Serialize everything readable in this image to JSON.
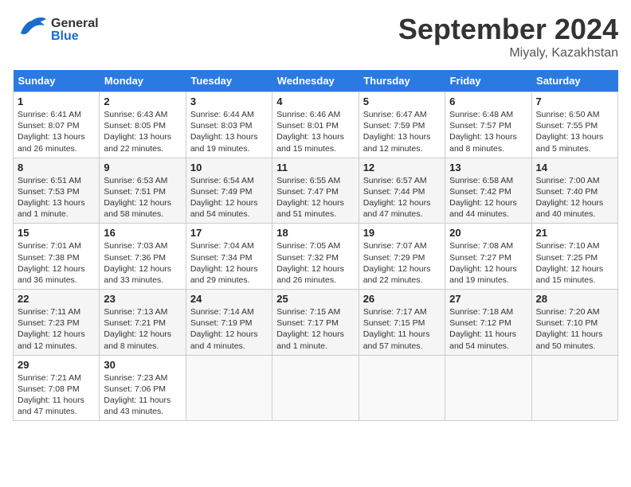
{
  "header": {
    "logo_general": "General",
    "logo_blue": "Blue",
    "month_title": "September 2024",
    "location": "Miyaly, Kazakhstan"
  },
  "days_of_week": [
    "Sunday",
    "Monday",
    "Tuesday",
    "Wednesday",
    "Thursday",
    "Friday",
    "Saturday"
  ],
  "weeks": [
    [
      {
        "day": "1",
        "sunrise": "Sunrise: 6:41 AM",
        "sunset": "Sunset: 8:07 PM",
        "daylight": "Daylight: 13 hours and 26 minutes."
      },
      {
        "day": "2",
        "sunrise": "Sunrise: 6:43 AM",
        "sunset": "Sunset: 8:05 PM",
        "daylight": "Daylight: 13 hours and 22 minutes."
      },
      {
        "day": "3",
        "sunrise": "Sunrise: 6:44 AM",
        "sunset": "Sunset: 8:03 PM",
        "daylight": "Daylight: 13 hours and 19 minutes."
      },
      {
        "day": "4",
        "sunrise": "Sunrise: 6:46 AM",
        "sunset": "Sunset: 8:01 PM",
        "daylight": "Daylight: 13 hours and 15 minutes."
      },
      {
        "day": "5",
        "sunrise": "Sunrise: 6:47 AM",
        "sunset": "Sunset: 7:59 PM",
        "daylight": "Daylight: 13 hours and 12 minutes."
      },
      {
        "day": "6",
        "sunrise": "Sunrise: 6:48 AM",
        "sunset": "Sunset: 7:57 PM",
        "daylight": "Daylight: 13 hours and 8 minutes."
      },
      {
        "day": "7",
        "sunrise": "Sunrise: 6:50 AM",
        "sunset": "Sunset: 7:55 PM",
        "daylight": "Daylight: 13 hours and 5 minutes."
      }
    ],
    [
      {
        "day": "8",
        "sunrise": "Sunrise: 6:51 AM",
        "sunset": "Sunset: 7:53 PM",
        "daylight": "Daylight: 13 hours and 1 minute."
      },
      {
        "day": "9",
        "sunrise": "Sunrise: 6:53 AM",
        "sunset": "Sunset: 7:51 PM",
        "daylight": "Daylight: 12 hours and 58 minutes."
      },
      {
        "day": "10",
        "sunrise": "Sunrise: 6:54 AM",
        "sunset": "Sunset: 7:49 PM",
        "daylight": "Daylight: 12 hours and 54 minutes."
      },
      {
        "day": "11",
        "sunrise": "Sunrise: 6:55 AM",
        "sunset": "Sunset: 7:47 PM",
        "daylight": "Daylight: 12 hours and 51 minutes."
      },
      {
        "day": "12",
        "sunrise": "Sunrise: 6:57 AM",
        "sunset": "Sunset: 7:44 PM",
        "daylight": "Daylight: 12 hours and 47 minutes."
      },
      {
        "day": "13",
        "sunrise": "Sunrise: 6:58 AM",
        "sunset": "Sunset: 7:42 PM",
        "daylight": "Daylight: 12 hours and 44 minutes."
      },
      {
        "day": "14",
        "sunrise": "Sunrise: 7:00 AM",
        "sunset": "Sunset: 7:40 PM",
        "daylight": "Daylight: 12 hours and 40 minutes."
      }
    ],
    [
      {
        "day": "15",
        "sunrise": "Sunrise: 7:01 AM",
        "sunset": "Sunset: 7:38 PM",
        "daylight": "Daylight: 12 hours and 36 minutes."
      },
      {
        "day": "16",
        "sunrise": "Sunrise: 7:03 AM",
        "sunset": "Sunset: 7:36 PM",
        "daylight": "Daylight: 12 hours and 33 minutes."
      },
      {
        "day": "17",
        "sunrise": "Sunrise: 7:04 AM",
        "sunset": "Sunset: 7:34 PM",
        "daylight": "Daylight: 12 hours and 29 minutes."
      },
      {
        "day": "18",
        "sunrise": "Sunrise: 7:05 AM",
        "sunset": "Sunset: 7:32 PM",
        "daylight": "Daylight: 12 hours and 26 minutes."
      },
      {
        "day": "19",
        "sunrise": "Sunrise: 7:07 AM",
        "sunset": "Sunset: 7:29 PM",
        "daylight": "Daylight: 12 hours and 22 minutes."
      },
      {
        "day": "20",
        "sunrise": "Sunrise: 7:08 AM",
        "sunset": "Sunset: 7:27 PM",
        "daylight": "Daylight: 12 hours and 19 minutes."
      },
      {
        "day": "21",
        "sunrise": "Sunrise: 7:10 AM",
        "sunset": "Sunset: 7:25 PM",
        "daylight": "Daylight: 12 hours and 15 minutes."
      }
    ],
    [
      {
        "day": "22",
        "sunrise": "Sunrise: 7:11 AM",
        "sunset": "Sunset: 7:23 PM",
        "daylight": "Daylight: 12 hours and 12 minutes."
      },
      {
        "day": "23",
        "sunrise": "Sunrise: 7:13 AM",
        "sunset": "Sunset: 7:21 PM",
        "daylight": "Daylight: 12 hours and 8 minutes."
      },
      {
        "day": "24",
        "sunrise": "Sunrise: 7:14 AM",
        "sunset": "Sunset: 7:19 PM",
        "daylight": "Daylight: 12 hours and 4 minutes."
      },
      {
        "day": "25",
        "sunrise": "Sunrise: 7:15 AM",
        "sunset": "Sunset: 7:17 PM",
        "daylight": "Daylight: 12 hours and 1 minute."
      },
      {
        "day": "26",
        "sunrise": "Sunrise: 7:17 AM",
        "sunset": "Sunset: 7:15 PM",
        "daylight": "Daylight: 11 hours and 57 minutes."
      },
      {
        "day": "27",
        "sunrise": "Sunrise: 7:18 AM",
        "sunset": "Sunset: 7:12 PM",
        "daylight": "Daylight: 11 hours and 54 minutes."
      },
      {
        "day": "28",
        "sunrise": "Sunrise: 7:20 AM",
        "sunset": "Sunset: 7:10 PM",
        "daylight": "Daylight: 11 hours and 50 minutes."
      }
    ],
    [
      {
        "day": "29",
        "sunrise": "Sunrise: 7:21 AM",
        "sunset": "Sunset: 7:08 PM",
        "daylight": "Daylight: 11 hours and 47 minutes."
      },
      {
        "day": "30",
        "sunrise": "Sunrise: 7:23 AM",
        "sunset": "Sunset: 7:06 PM",
        "daylight": "Daylight: 11 hours and 43 minutes."
      },
      null,
      null,
      null,
      null,
      null
    ]
  ]
}
